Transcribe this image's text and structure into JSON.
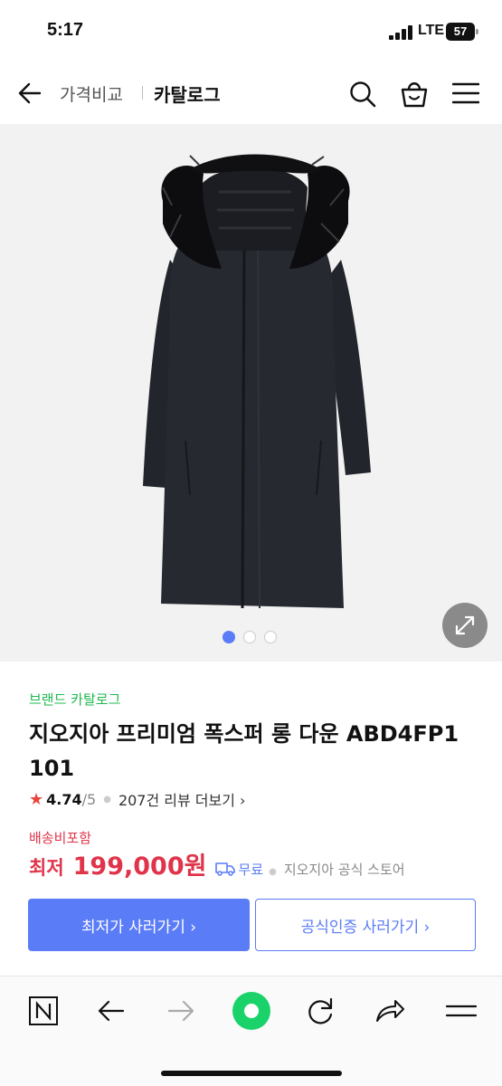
{
  "status": {
    "time": "5:17",
    "network": "LTE",
    "battery": "57"
  },
  "nav": {
    "sub_label": "가격비교",
    "title": "카탈로그"
  },
  "gallery": {
    "total_images": 3,
    "current_index": 1
  },
  "product": {
    "brand_link": "브랜드 카탈로그",
    "title": "지오지아 프리미엄 폭스퍼 롱 다운 ABD4FP1 101",
    "rating": "4.74",
    "rating_max": "/5",
    "review_link": "207건 리뷰 더보기 ›",
    "shipping_note": "배송비포함",
    "price_label": "최저",
    "price": "199,000원",
    "free_shipping": "무료",
    "store": "지오지아 공식 스토어"
  },
  "buttons": {
    "lowest": "최저가 사러가기 ›",
    "official": "공식인증 사러가기 ›"
  },
  "colors": {
    "accent": "#5b7cf7",
    "price": "#e0344a",
    "brand_green": "#1eb84f",
    "browser_green": "#19d36a"
  }
}
